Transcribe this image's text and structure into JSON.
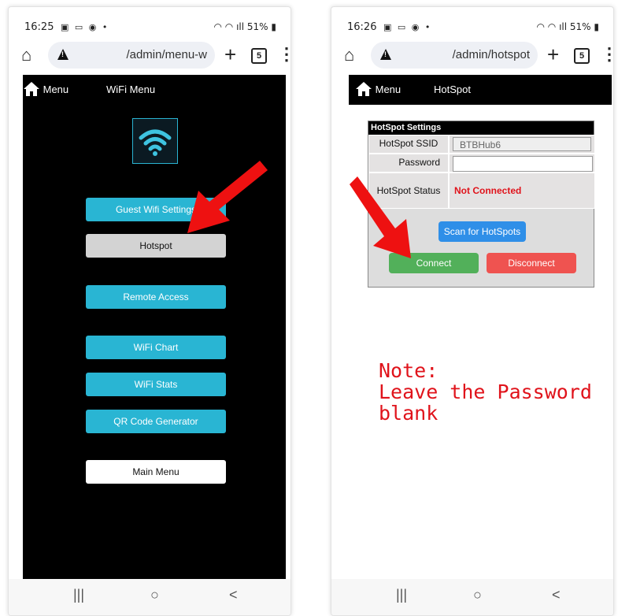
{
  "left": {
    "status": {
      "time": "16:25",
      "icons": "▣ ▭ ◉ •",
      "right": "51%"
    },
    "url": "/admin/menu-w",
    "tab_count": "5",
    "header": {
      "menu_label": "Menu",
      "title": "WiFi Menu"
    },
    "buttons": {
      "guest": "Guest Wifi Settings",
      "hotspot": "Hotspot",
      "remote": "Remote Access",
      "chart": "WiFi Chart",
      "stats": "WiFi Stats",
      "qr": "QR Code Generator",
      "main": "Main Menu"
    }
  },
  "right": {
    "status": {
      "time": "16:26",
      "icons": "▣ ▭ ◉ •",
      "right": "51%"
    },
    "url": "/admin/hotspot",
    "tab_count": "5",
    "header": {
      "menu_label": "Menu",
      "title": "HotSpot"
    },
    "settings": {
      "heading": "HotSpot Settings",
      "ssid_label": "HotSpot SSID",
      "ssid_value": "BTBHub6",
      "password_label": "Password",
      "password_value": "",
      "status_label": "HotSpot Status",
      "status_value": "Not Connected",
      "scan": "Scan for HotSpots",
      "connect": "Connect",
      "disconnect": "Disconnect"
    },
    "note_title": "Note:",
    "note_body": "Leave the Password blank"
  },
  "nav": {
    "recents": "|||",
    "home": "○",
    "back": "<"
  },
  "colors": {
    "menu_button": "#29b5d3",
    "arrow": "#ee1111",
    "note": "#e0131b",
    "connect": "#52b05a",
    "disconnect": "#ef5350",
    "scan": "#2f8fe8"
  }
}
